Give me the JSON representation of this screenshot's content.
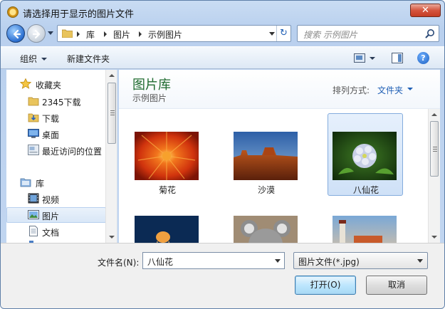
{
  "window": {
    "title": "请选择用于显示的图片文件",
    "close_glyph": "✕"
  },
  "navigation": {
    "breadcrumb": [
      "库",
      "图片",
      "示例图片"
    ],
    "refresh_glyph": "↻",
    "search_placeholder": "搜索 示例图片"
  },
  "toolbar": {
    "organize_label": "组织",
    "new_folder_label": "新建文件夹",
    "help_glyph": "?"
  },
  "sidebar": {
    "items": [
      {
        "label": "收藏夹",
        "icon": "star-icon",
        "selected": false
      },
      {
        "label": "2345下载",
        "icon": "folder-icon",
        "selected": false
      },
      {
        "label": "下载",
        "icon": "download-folder-icon",
        "selected": false
      },
      {
        "label": "桌面",
        "icon": "desktop-icon",
        "selected": false
      },
      {
        "label": "最近访问的位置",
        "icon": "recent-places-icon",
        "selected": false
      },
      {
        "label": "库",
        "icon": "library-icon",
        "selected": false
      },
      {
        "label": "视频",
        "icon": "video-icon",
        "selected": false
      },
      {
        "label": "图片",
        "icon": "pictures-icon",
        "selected": true
      },
      {
        "label": "文档",
        "icon": "document-icon",
        "selected": false
      }
    ]
  },
  "content": {
    "library_title": "图片库",
    "library_subtitle": "示例图片",
    "arrange_label": "排列方式:",
    "arrange_value": "文件夹",
    "files": [
      {
        "name": "菊花",
        "thumb": "chrysanthemum",
        "selected": false
      },
      {
        "name": "沙漠",
        "thumb": "desert",
        "selected": false
      },
      {
        "name": "八仙花",
        "thumb": "hydrangeas",
        "selected": true
      },
      {
        "name": "",
        "thumb": "jellyfish",
        "selected": false
      },
      {
        "name": "",
        "thumb": "koala",
        "selected": false
      },
      {
        "name": "",
        "thumb": "lighthouse",
        "selected": false
      }
    ]
  },
  "bottom": {
    "filename_label": "文件名(N):",
    "filename_value": "八仙花",
    "filetype_value": "图片文件(*.jpg)",
    "open_label": "打开(O)",
    "cancel_label": "取消"
  },
  "colors": {
    "accent_blue": "#1f5fb5",
    "library_title_green": "#1e6a2e",
    "selection_fill": "#cfe1f7",
    "close_red": "#c43c23"
  }
}
